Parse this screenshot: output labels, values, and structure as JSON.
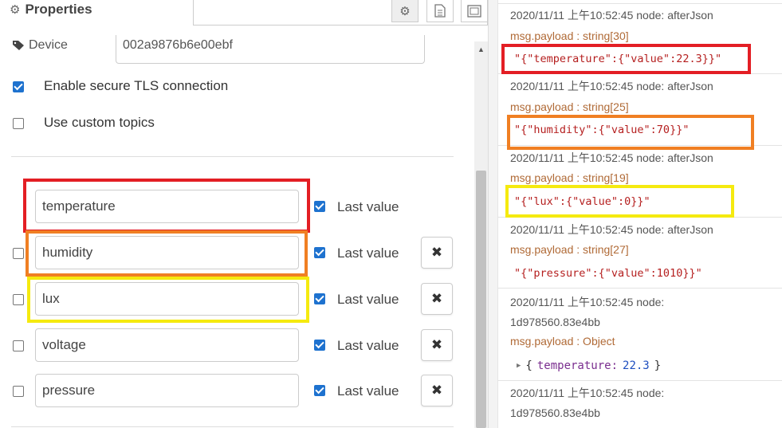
{
  "header": {
    "title": "Properties"
  },
  "device": {
    "label": "Device",
    "value": "002a9876b6e00ebf"
  },
  "options": [
    {
      "label": "Enable secure TLS connection",
      "checked": true
    },
    {
      "label": "Use custom topics",
      "checked": false
    }
  ],
  "topics": [
    {
      "name": "temperature",
      "last_value_label": "Last value",
      "last_value_checked": true,
      "row_checked": false
    },
    {
      "name": "humidity",
      "last_value_label": "Last value",
      "last_value_checked": true,
      "row_checked": false
    },
    {
      "name": "lux",
      "last_value_label": "Last value",
      "last_value_checked": true,
      "row_checked": false
    },
    {
      "name": "voltage",
      "last_value_label": "Last value",
      "last_value_checked": true,
      "row_checked": false
    },
    {
      "name": "pressure",
      "last_value_label": "Last value",
      "last_value_checked": true,
      "row_checked": false
    }
  ],
  "delete_label": "✖",
  "highlight_colors": {
    "red": "#e31e24",
    "orange": "#f07f23",
    "yellow": "#f5ea0f"
  },
  "debug": {
    "messages": [
      {
        "header": "2020/11/11 上午10:52:45   node: afterJson",
        "type": "msg.payload : string[30]",
        "value": "\"{\"temperature\":{\"value\":22.3}}\""
      },
      {
        "header": "2020/11/11 上午10:52:45   node: afterJson",
        "type": "msg.payload : string[25]",
        "value": "\"{\"humidity\":{\"value\":70}}\""
      },
      {
        "header": "2020/11/11 上午10:52:45   node: afterJson",
        "type": "msg.payload : string[19]",
        "value": "\"{\"lux\":{\"value\":0}}\""
      },
      {
        "header": "2020/11/11 上午10:52:45   node: afterJson",
        "type": "msg.payload : string[27]",
        "value": "\"{\"pressure\":{\"value\":1010}}\""
      },
      {
        "header_line1": "2020/11/11 上午10:52:45   node:",
        "header_line2": "1d978560.83e4bb",
        "type": "msg.payload : Object",
        "obj_open": "{",
        "obj_key": "temperature:",
        "obj_val": "22.3",
        "obj_close": "}"
      },
      {
        "header_line1": "2020/11/11 上午10:52:45   node:",
        "header_line2": "1d978560.83e4bb"
      }
    ]
  }
}
